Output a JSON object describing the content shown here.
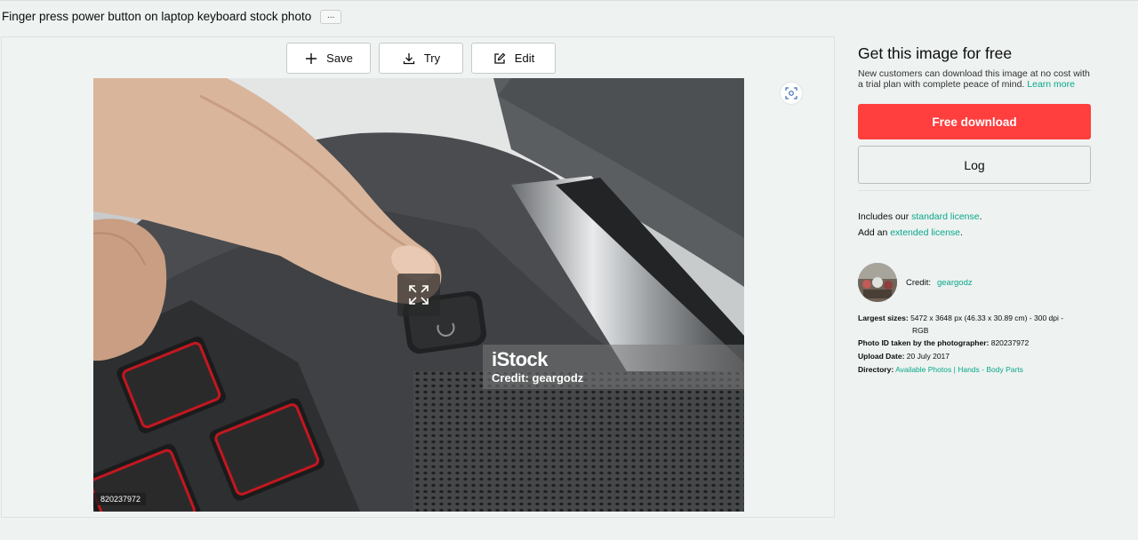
{
  "page": {
    "title": "Finger press power button on laptop keyboard stock photo",
    "more_label": "..."
  },
  "toolbar": {
    "save_label": "Save",
    "try_label": "Try",
    "edit_label": "Edit"
  },
  "image": {
    "watermark_brand": "iStock",
    "watermark_credit": "Credit: geargodz",
    "photo_id_badge": "820237972"
  },
  "sidebar": {
    "heading": "Get this image for free",
    "description": "New customers can download this image at no cost with a trial plan with complete peace of mind.",
    "learn_more": "Learn more",
    "free_download_label": "Free download",
    "log_label": "Log",
    "license_prefix": "Includes our",
    "license_link": "standard license",
    "license_suffix": ".",
    "extended_prefix": "Add an",
    "extended_link": "extended license",
    "extended_suffix": "."
  },
  "credit": {
    "label": "Credit:",
    "name": "geargodz"
  },
  "details": {
    "largest_label": "Largest sizes:",
    "largest_value": "5472 x 3648 px (46.33 x 30.89 cm) - 300 dpi -",
    "largest_value_2": "RGB",
    "photo_id_label": "Photo ID taken by the photographer:",
    "photo_id_value": "820237972",
    "upload_label": "Upload Date:",
    "upload_value": "20 July 2017",
    "directory_label": "Directory:",
    "directory_link_1": "Available Photos",
    "directory_sep": "|",
    "directory_link_2": "Hands - Body Parts"
  },
  "colors": {
    "accent_red": "#ff3e3e",
    "link_teal": "#08a88a",
    "background": "#eef2f1"
  },
  "icons": {
    "save": "plus-icon",
    "try": "download-icon",
    "edit": "edit-icon",
    "expand": "expand-icon",
    "visual_search": "visual-search-icon"
  }
}
